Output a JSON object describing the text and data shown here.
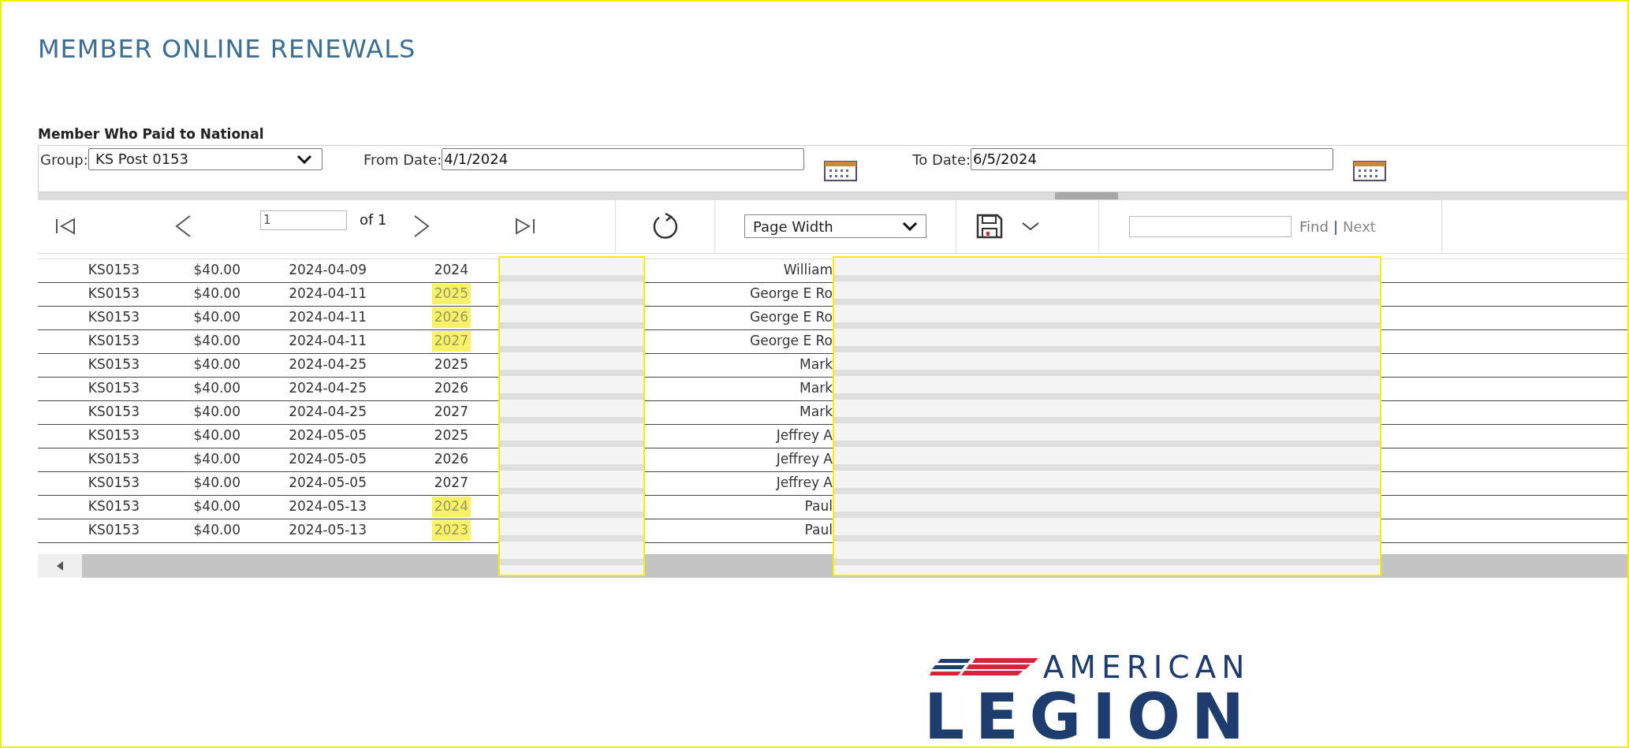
{
  "title": "MEMBER ONLINE RENEWALS",
  "section_label": "Member Who Paid to National",
  "parameters": [
    {
      "kind": "select",
      "label": "Group:",
      "value": "KS Post 0153"
    },
    {
      "kind": "date",
      "label": "From Date:",
      "value": "4/1/2024"
    },
    {
      "kind": "date",
      "label": "To Date:",
      "value": "6/5/2024"
    }
  ],
  "toolbar": {
    "page": "1",
    "page_count": "of 1",
    "zoom": "Page Width",
    "find": "Find",
    "separator": "|",
    "next": "Next"
  },
  "rows": [
    {
      "post": "KS0153",
      "amount": "$40.00",
      "date": "2024-04-09",
      "year": "2024",
      "highlighted": false,
      "name": "William"
    },
    {
      "post": "KS0153",
      "amount": "$40.00",
      "date": "2024-04-11",
      "year": "2025",
      "highlighted": true,
      "name": "George E Ro"
    },
    {
      "post": "KS0153",
      "amount": "$40.00",
      "date": "2024-04-11",
      "year": "2026",
      "highlighted": true,
      "name": "George E Ro"
    },
    {
      "post": "KS0153",
      "amount": "$40.00",
      "date": "2024-04-11",
      "year": "2027",
      "highlighted": true,
      "name": "George E Ro"
    },
    {
      "post": "KS0153",
      "amount": "$40.00",
      "date": "2024-04-25",
      "year": "2025",
      "highlighted": false,
      "name": "Mark"
    },
    {
      "post": "KS0153",
      "amount": "$40.00",
      "date": "2024-04-25",
      "year": "2026",
      "highlighted": false,
      "name": "Mark"
    },
    {
      "post": "KS0153",
      "amount": "$40.00",
      "date": "2024-04-25",
      "year": "2027",
      "highlighted": false,
      "name": "Mark"
    },
    {
      "post": "KS0153",
      "amount": "$40.00",
      "date": "2024-05-05",
      "year": "2025",
      "highlighted": false,
      "name": "Jeffrey A"
    },
    {
      "post": "KS0153",
      "amount": "$40.00",
      "date": "2024-05-05",
      "year": "2026",
      "highlighted": false,
      "name": "Jeffrey A"
    },
    {
      "post": "KS0153",
      "amount": "$40.00",
      "date": "2024-05-05",
      "year": "2027",
      "highlighted": false,
      "name": "Jeffrey A"
    },
    {
      "post": "KS0153",
      "amount": "$40.00",
      "date": "2024-05-13",
      "year": "2024",
      "highlighted": true,
      "name": "Paul"
    },
    {
      "post": "KS0153",
      "amount": "$40.00",
      "date": "2024-05-13",
      "year": "2023",
      "highlighted": true,
      "name": "Paul"
    }
  ],
  "logo": {
    "line_1": "AMERICAN",
    "line_2": "LEGION"
  }
}
